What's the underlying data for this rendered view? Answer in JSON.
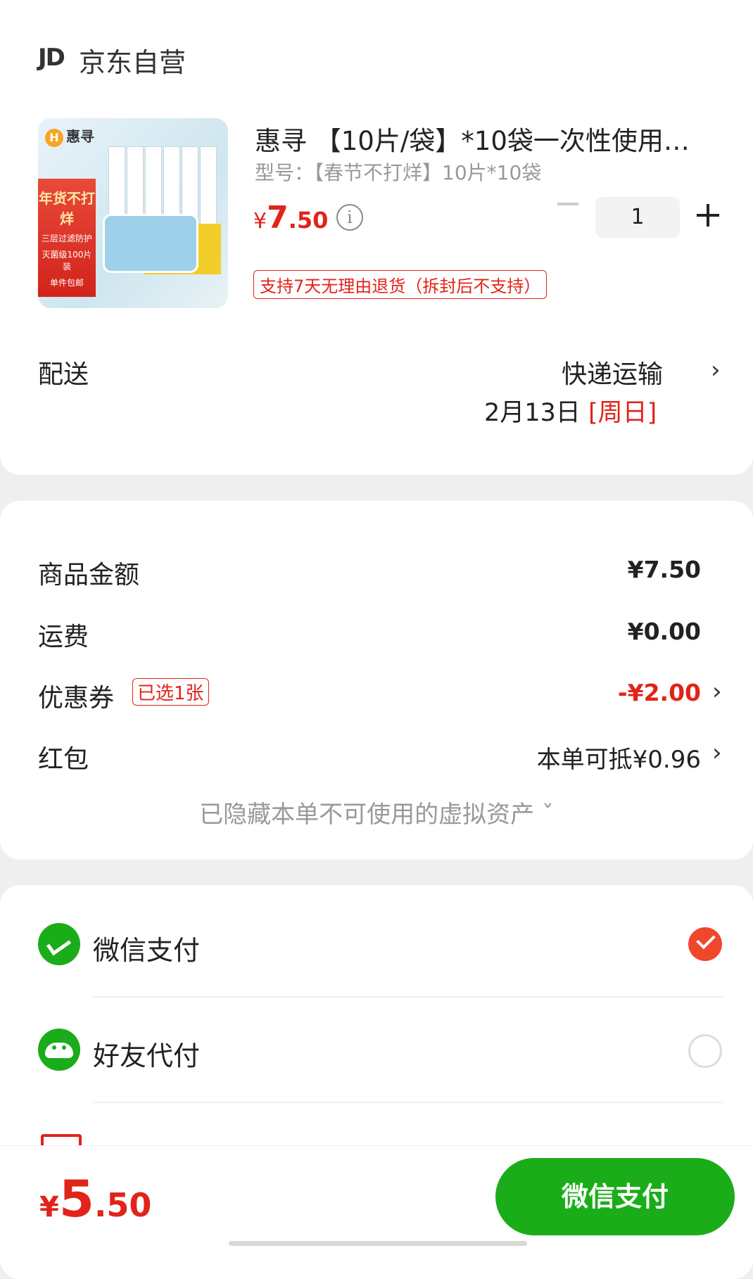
{
  "store": {
    "logo": "JD",
    "name": "京东自营"
  },
  "product": {
    "image_brand": "惠寻",
    "image_badges": [
      "年货不打烊",
      "三层过滤防护",
      "灭菌级100片装",
      "单件包邮"
    ],
    "title": "惠寻 【10片/袋】*10袋一次性使用…",
    "spec": "型号：【春节不打烊】10片*10袋",
    "price_symbol": "¥",
    "price_int": "7",
    "price_dec": ".50",
    "info_icon": "i",
    "quantity": "1",
    "return_policy": "支持7天无理由退货（拆封后不支持）"
  },
  "delivery": {
    "label": "配送",
    "method": "快递运输",
    "date": "2月13日",
    "weekday": "[周日]",
    "chevron": "›"
  },
  "summary": {
    "goods_label": "商品金额",
    "goods_value": "¥7.50",
    "freight_label": "运费",
    "freight_value": "¥0.00",
    "coupon_label": "优惠券",
    "coupon_tag": "已选1张",
    "coupon_value": "-¥2.00",
    "redpacket_label": "红包",
    "redpacket_value": "本单可抵¥0.96",
    "hidden_note": "已隐藏本单不可使用的虚拟资产 ˇ",
    "chevron": "›"
  },
  "payment": {
    "methods": [
      {
        "label": "微信支付",
        "icon": "wechat-pay-icon",
        "selected": true
      },
      {
        "label": "好友代付",
        "icon": "friend-pay-icon",
        "selected": false
      }
    ]
  },
  "footer": {
    "price_symbol": "¥",
    "total_int": "5",
    "total_dec": ".50",
    "pay_button": "微信支付"
  },
  "colors": {
    "accent_red": "#e2231a",
    "wechat_green": "#1aad19",
    "check_orange": "#f0462b"
  }
}
